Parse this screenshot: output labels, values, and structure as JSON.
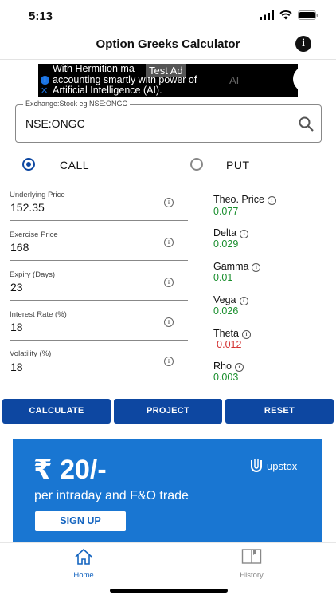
{
  "status_bar": {
    "time": "5:13"
  },
  "header": {
    "title": "Option Greeks Calculator"
  },
  "ad": {
    "badge": "Test Ad",
    "line1": "With Hermition ma",
    "line2": "accounting smartly with power of",
    "line3": "Artificial Intelligence (AI).",
    "ai_tail": "AI"
  },
  "search": {
    "label": "Exchange:Stock eg NSE:ONGC",
    "value": "NSE:ONGC"
  },
  "option_type": {
    "call_label": "CALL",
    "put_label": "PUT",
    "selected": "CALL"
  },
  "inputs": [
    {
      "label": "Underlying Price",
      "value": "152.35"
    },
    {
      "label": "Exercise Price",
      "value": "168"
    },
    {
      "label": "Expiry (Days)",
      "value": "23"
    },
    {
      "label": "Interest Rate (%)",
      "value": "18"
    },
    {
      "label": "Volatility (%)",
      "value": "18"
    }
  ],
  "results": [
    {
      "label": "Theo. Price",
      "value": "0.077",
      "color": "#1a8f2e"
    },
    {
      "label": "Delta",
      "value": "0.029",
      "color": "#1a8f2e"
    },
    {
      "label": "Gamma",
      "value": "0.01",
      "color": "#1a8f2e"
    },
    {
      "label": "Vega",
      "value": "0.026",
      "color": "#1a8f2e"
    },
    {
      "label": "Theta",
      "value": "-0.012",
      "color": "#d32f2f"
    },
    {
      "label": "Rho",
      "value": "0.003",
      "color": "#1a8f2e"
    }
  ],
  "buttons": {
    "calculate": "CALCULATE",
    "project": "PROJECT",
    "reset": "RESET"
  },
  "banner": {
    "price": "₹ 20/-",
    "subtitle": "per intraday and F&O trade",
    "cta": "SIGN UP",
    "brand": "upstox"
  },
  "tabs": {
    "home": "Home",
    "history": "History",
    "active": "Home"
  },
  "colors": {
    "primary": "#0d47a1",
    "banner": "#1976d2",
    "positive": "#1a8f2e",
    "negative": "#d32f2f"
  }
}
